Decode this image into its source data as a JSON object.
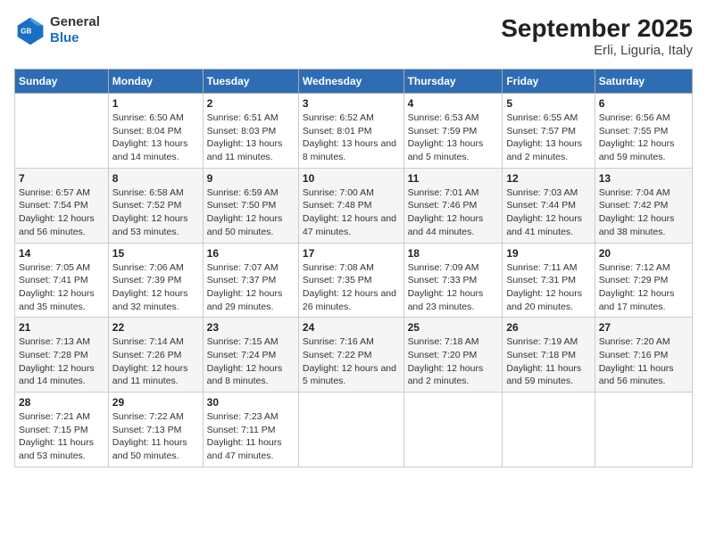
{
  "logo": {
    "line1": "General",
    "line2": "Blue"
  },
  "title": "September 2025",
  "subtitle": "Erli, Liguria, Italy",
  "headers": [
    "Sunday",
    "Monday",
    "Tuesday",
    "Wednesday",
    "Thursday",
    "Friday",
    "Saturday"
  ],
  "weeks": [
    [
      {
        "day": "",
        "sunrise": "",
        "sunset": "",
        "daylight": ""
      },
      {
        "day": "1",
        "sunrise": "Sunrise: 6:50 AM",
        "sunset": "Sunset: 8:04 PM",
        "daylight": "Daylight: 13 hours and 14 minutes."
      },
      {
        "day": "2",
        "sunrise": "Sunrise: 6:51 AM",
        "sunset": "Sunset: 8:03 PM",
        "daylight": "Daylight: 13 hours and 11 minutes."
      },
      {
        "day": "3",
        "sunrise": "Sunrise: 6:52 AM",
        "sunset": "Sunset: 8:01 PM",
        "daylight": "Daylight: 13 hours and 8 minutes."
      },
      {
        "day": "4",
        "sunrise": "Sunrise: 6:53 AM",
        "sunset": "Sunset: 7:59 PM",
        "daylight": "Daylight: 13 hours and 5 minutes."
      },
      {
        "day": "5",
        "sunrise": "Sunrise: 6:55 AM",
        "sunset": "Sunset: 7:57 PM",
        "daylight": "Daylight: 13 hours and 2 minutes."
      },
      {
        "day": "6",
        "sunrise": "Sunrise: 6:56 AM",
        "sunset": "Sunset: 7:55 PM",
        "daylight": "Daylight: 12 hours and 59 minutes."
      }
    ],
    [
      {
        "day": "7",
        "sunrise": "Sunrise: 6:57 AM",
        "sunset": "Sunset: 7:54 PM",
        "daylight": "Daylight: 12 hours and 56 minutes."
      },
      {
        "day": "8",
        "sunrise": "Sunrise: 6:58 AM",
        "sunset": "Sunset: 7:52 PM",
        "daylight": "Daylight: 12 hours and 53 minutes."
      },
      {
        "day": "9",
        "sunrise": "Sunrise: 6:59 AM",
        "sunset": "Sunset: 7:50 PM",
        "daylight": "Daylight: 12 hours and 50 minutes."
      },
      {
        "day": "10",
        "sunrise": "Sunrise: 7:00 AM",
        "sunset": "Sunset: 7:48 PM",
        "daylight": "Daylight: 12 hours and 47 minutes."
      },
      {
        "day": "11",
        "sunrise": "Sunrise: 7:01 AM",
        "sunset": "Sunset: 7:46 PM",
        "daylight": "Daylight: 12 hours and 44 minutes."
      },
      {
        "day": "12",
        "sunrise": "Sunrise: 7:03 AM",
        "sunset": "Sunset: 7:44 PM",
        "daylight": "Daylight: 12 hours and 41 minutes."
      },
      {
        "day": "13",
        "sunrise": "Sunrise: 7:04 AM",
        "sunset": "Sunset: 7:42 PM",
        "daylight": "Daylight: 12 hours and 38 minutes."
      }
    ],
    [
      {
        "day": "14",
        "sunrise": "Sunrise: 7:05 AM",
        "sunset": "Sunset: 7:41 PM",
        "daylight": "Daylight: 12 hours and 35 minutes."
      },
      {
        "day": "15",
        "sunrise": "Sunrise: 7:06 AM",
        "sunset": "Sunset: 7:39 PM",
        "daylight": "Daylight: 12 hours and 32 minutes."
      },
      {
        "day": "16",
        "sunrise": "Sunrise: 7:07 AM",
        "sunset": "Sunset: 7:37 PM",
        "daylight": "Daylight: 12 hours and 29 minutes."
      },
      {
        "day": "17",
        "sunrise": "Sunrise: 7:08 AM",
        "sunset": "Sunset: 7:35 PM",
        "daylight": "Daylight: 12 hours and 26 minutes."
      },
      {
        "day": "18",
        "sunrise": "Sunrise: 7:09 AM",
        "sunset": "Sunset: 7:33 PM",
        "daylight": "Daylight: 12 hours and 23 minutes."
      },
      {
        "day": "19",
        "sunrise": "Sunrise: 7:11 AM",
        "sunset": "Sunset: 7:31 PM",
        "daylight": "Daylight: 12 hours and 20 minutes."
      },
      {
        "day": "20",
        "sunrise": "Sunrise: 7:12 AM",
        "sunset": "Sunset: 7:29 PM",
        "daylight": "Daylight: 12 hours and 17 minutes."
      }
    ],
    [
      {
        "day": "21",
        "sunrise": "Sunrise: 7:13 AM",
        "sunset": "Sunset: 7:28 PM",
        "daylight": "Daylight: 12 hours and 14 minutes."
      },
      {
        "day": "22",
        "sunrise": "Sunrise: 7:14 AM",
        "sunset": "Sunset: 7:26 PM",
        "daylight": "Daylight: 12 hours and 11 minutes."
      },
      {
        "day": "23",
        "sunrise": "Sunrise: 7:15 AM",
        "sunset": "Sunset: 7:24 PM",
        "daylight": "Daylight: 12 hours and 8 minutes."
      },
      {
        "day": "24",
        "sunrise": "Sunrise: 7:16 AM",
        "sunset": "Sunset: 7:22 PM",
        "daylight": "Daylight: 12 hours and 5 minutes."
      },
      {
        "day": "25",
        "sunrise": "Sunrise: 7:18 AM",
        "sunset": "Sunset: 7:20 PM",
        "daylight": "Daylight: 12 hours and 2 minutes."
      },
      {
        "day": "26",
        "sunrise": "Sunrise: 7:19 AM",
        "sunset": "Sunset: 7:18 PM",
        "daylight": "Daylight: 11 hours and 59 minutes."
      },
      {
        "day": "27",
        "sunrise": "Sunrise: 7:20 AM",
        "sunset": "Sunset: 7:16 PM",
        "daylight": "Daylight: 11 hours and 56 minutes."
      }
    ],
    [
      {
        "day": "28",
        "sunrise": "Sunrise: 7:21 AM",
        "sunset": "Sunset: 7:15 PM",
        "daylight": "Daylight: 11 hours and 53 minutes."
      },
      {
        "day": "29",
        "sunrise": "Sunrise: 7:22 AM",
        "sunset": "Sunset: 7:13 PM",
        "daylight": "Daylight: 11 hours and 50 minutes."
      },
      {
        "day": "30",
        "sunrise": "Sunrise: 7:23 AM",
        "sunset": "Sunset: 7:11 PM",
        "daylight": "Daylight: 11 hours and 47 minutes."
      },
      {
        "day": "",
        "sunrise": "",
        "sunset": "",
        "daylight": ""
      },
      {
        "day": "",
        "sunrise": "",
        "sunset": "",
        "daylight": ""
      },
      {
        "day": "",
        "sunrise": "",
        "sunset": "",
        "daylight": ""
      },
      {
        "day": "",
        "sunrise": "",
        "sunset": "",
        "daylight": ""
      }
    ]
  ]
}
